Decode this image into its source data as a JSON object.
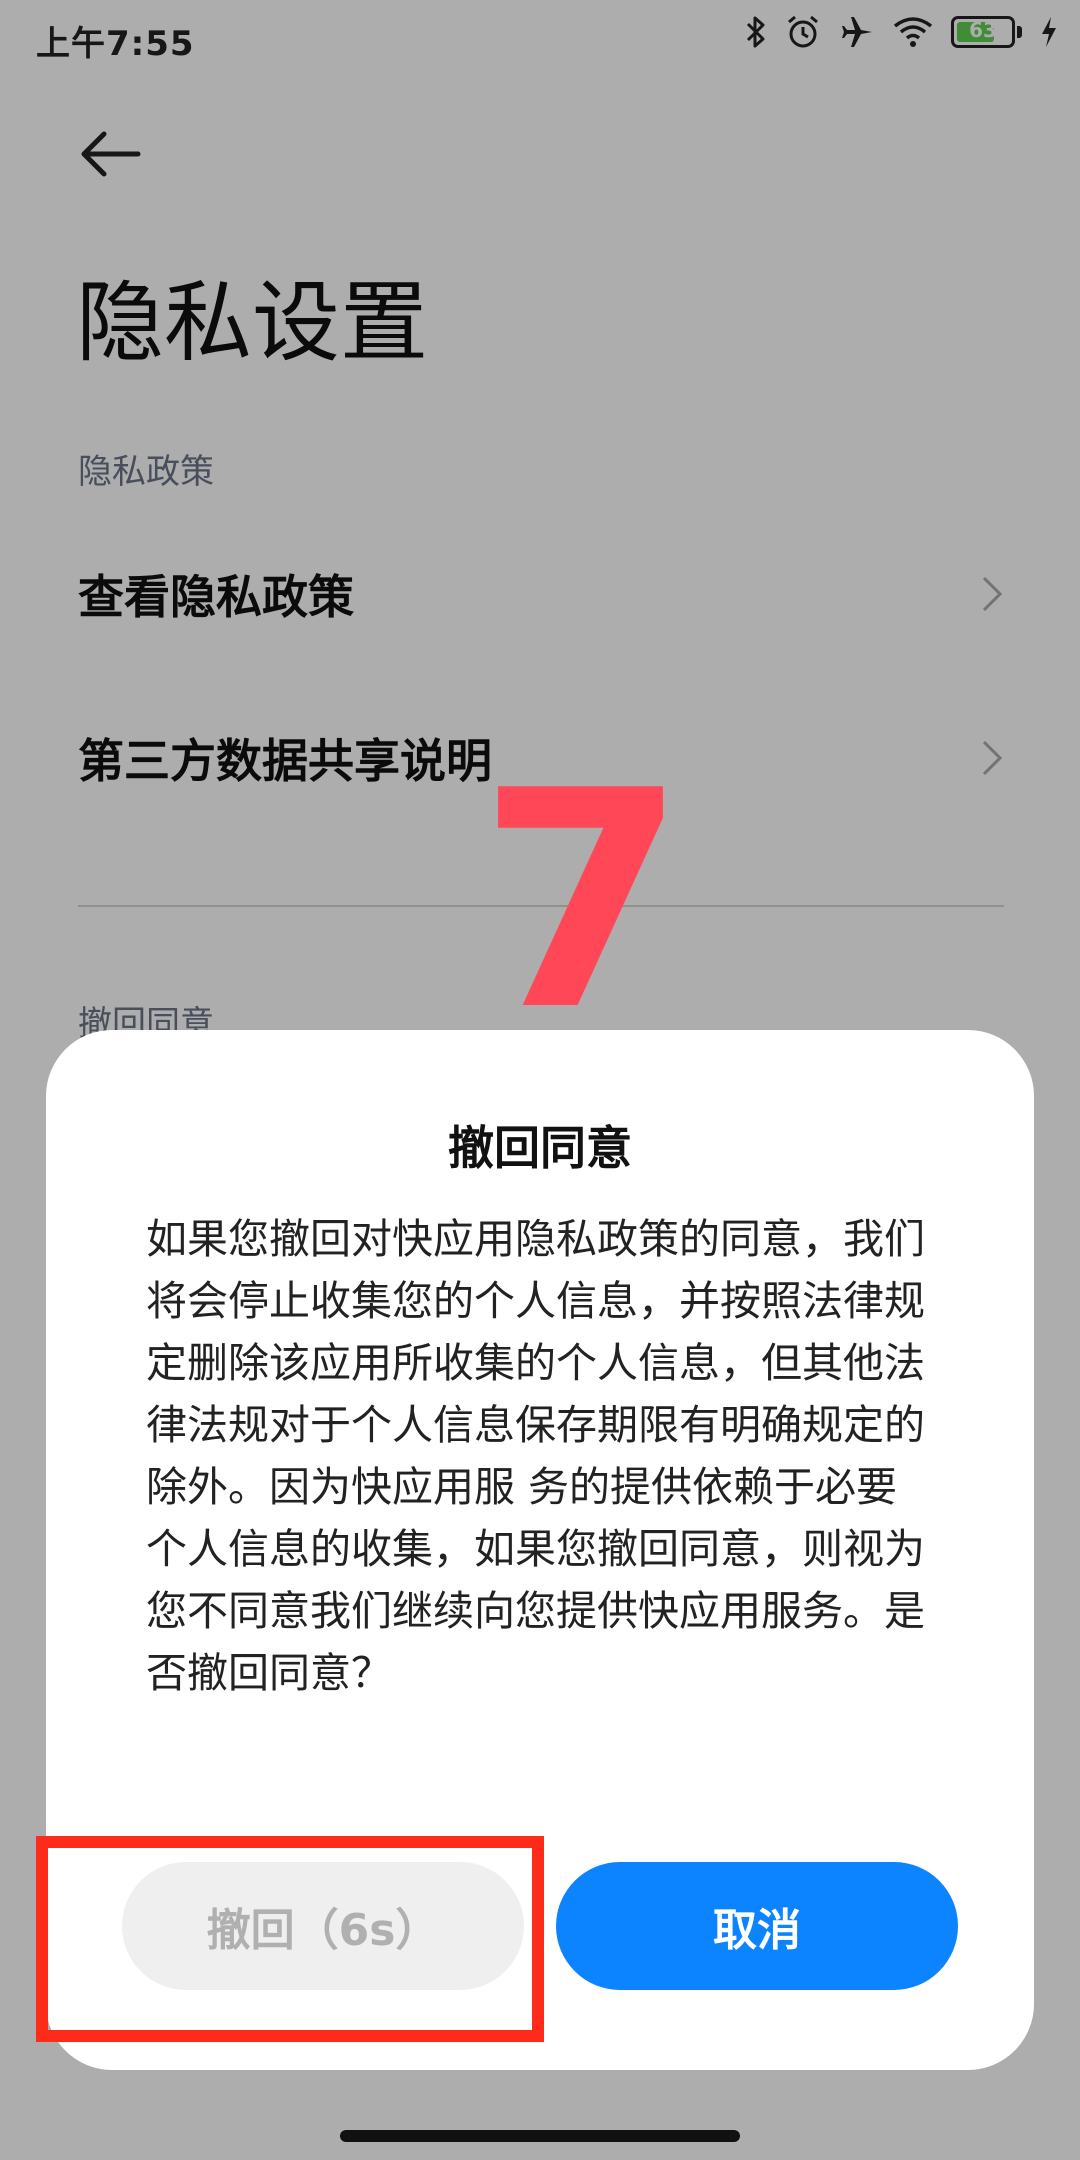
{
  "status_bar": {
    "time": "上午7:55",
    "battery_level": "63",
    "icons": [
      "bluetooth-icon",
      "alarm-icon",
      "airplane-icon",
      "wifi-icon",
      "battery-icon",
      "charging-icon"
    ]
  },
  "page": {
    "title": "隐私设置",
    "section_privacy": "隐私政策",
    "items": [
      {
        "label": "查看隐私政策"
      },
      {
        "label": "第三方数据共享说明"
      }
    ],
    "section_withdraw": "撤回同意"
  },
  "overlay_number": "7",
  "dialog": {
    "title": "撤回同意",
    "body": "如果您撤回对快应用隐私政策的同意，我们将会停止收集您的个人信息，并按照法律规定删除该应用所收集的个人信息，但其他法律法规对于个人信息保存期限有明确规定的除外。因为快应用服 务的提供依赖于必要个人信息的收集，如果您撤回同意，则视为您不同意我们继续向您提供快应用服务。是否撤回同意？",
    "withdraw_button": "撤回（6s）",
    "cancel_button": "取消"
  },
  "colors": {
    "accent": "#0d84ff",
    "highlight": "#ff2b1a",
    "overlay_number": "#ff4757"
  }
}
